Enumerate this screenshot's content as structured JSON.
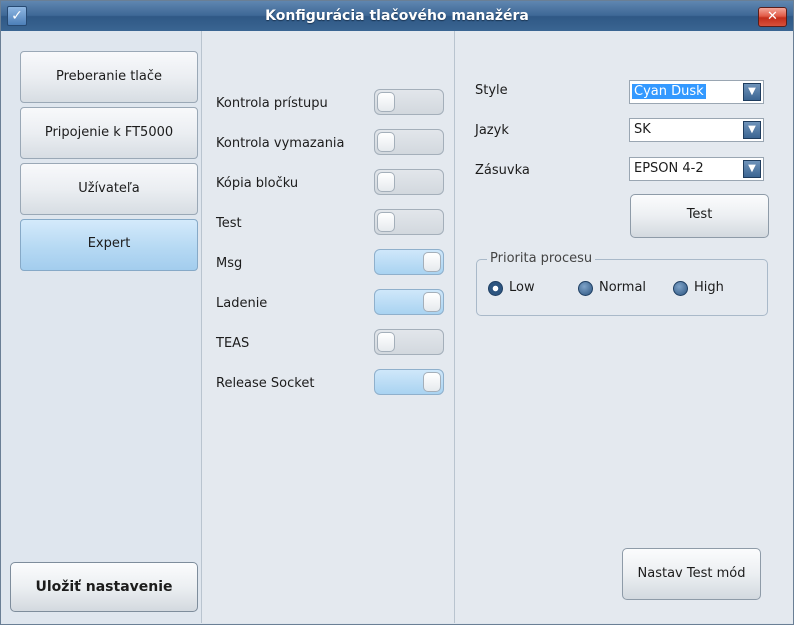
{
  "window": {
    "title": "Konfigurácia tlačového manažéra",
    "close_glyph": "✕",
    "app_icon_glyph": "✓"
  },
  "nav": {
    "items": [
      {
        "label": "Preberanie tlače",
        "active": false
      },
      {
        "label": "Pripojenie k FT5000",
        "active": false
      },
      {
        "label": "Užívateľa",
        "active": false
      },
      {
        "label": "Expert",
        "active": true
      }
    ],
    "save_label": "Uložiť nastavenie"
  },
  "toggles": [
    {
      "label": "Kontrola prístupu",
      "on": false
    },
    {
      "label": "Kontrola vymazania",
      "on": false
    },
    {
      "label": "Kópia bločku",
      "on": false
    },
    {
      "label": "Test",
      "on": false
    },
    {
      "label": "Msg",
      "on": true
    },
    {
      "label": "Ladenie",
      "on": true
    },
    {
      "label": "TEAS",
      "on": false
    },
    {
      "label": "Release Socket",
      "on": true
    }
  ],
  "settings": {
    "style": {
      "label": "Style",
      "value": "Cyan Dusk"
    },
    "language": {
      "label": "Jazyk",
      "value": "SK"
    },
    "socket": {
      "label": "Zásuvka",
      "value": "EPSON 4-2"
    },
    "test_label": "Test",
    "priority": {
      "title": "Priorita procesu",
      "options": [
        {
          "label": "Low",
          "checked": true
        },
        {
          "label": "Normal",
          "checked": false
        },
        {
          "label": "High",
          "checked": false
        }
      ]
    },
    "test_mode_label": "Nastav Test mód"
  },
  "colors": {
    "titlebar": "#3e6896",
    "accent_selected": "#a9d3f1",
    "close": "#c42e1b"
  }
}
